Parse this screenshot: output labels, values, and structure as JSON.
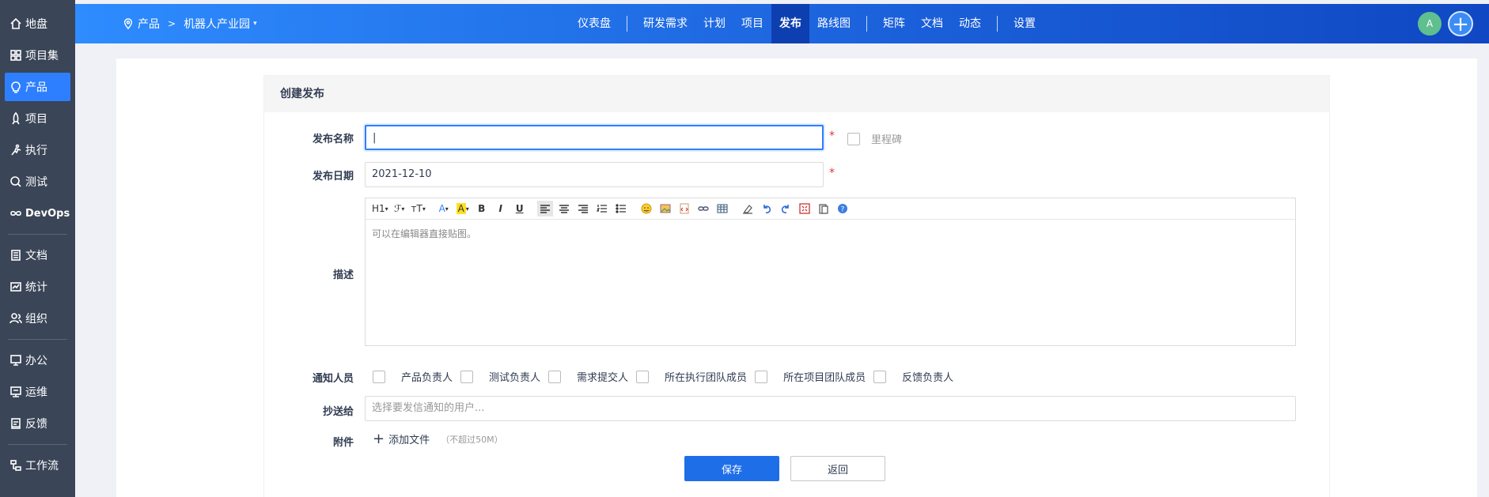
{
  "sidebar": {
    "items": [
      {
        "label": "地盘",
        "icon": "home-icon",
        "active": false
      },
      {
        "label": "项目集",
        "icon": "grid-icon",
        "active": false
      },
      {
        "label": "产品",
        "icon": "lightbulb-icon",
        "active": true
      },
      {
        "label": "项目",
        "icon": "rocket-icon",
        "active": false
      },
      {
        "label": "执行",
        "icon": "run-icon",
        "active": false
      },
      {
        "label": "测试",
        "icon": "magnifier-icon",
        "active": false
      },
      {
        "label": "DevOps",
        "icon": "infinity-icon",
        "active": false
      },
      {
        "label": "文档",
        "icon": "document-icon",
        "active": false
      },
      {
        "label": "统计",
        "icon": "chart-icon",
        "active": false
      },
      {
        "label": "组织",
        "icon": "people-icon",
        "active": false
      },
      {
        "label": "办公",
        "icon": "office-icon",
        "active": false
      },
      {
        "label": "运维",
        "icon": "ops-icon",
        "active": false
      },
      {
        "label": "反馈",
        "icon": "feedback-icon",
        "active": false
      },
      {
        "label": "工作流",
        "icon": "workflow-icon",
        "active": false
      }
    ]
  },
  "header": {
    "breadcrumb": {
      "root": "产品",
      "separator": ">",
      "current": "机器人产业园"
    },
    "nav": [
      {
        "label": "仪表盘"
      },
      {
        "label": "研发需求"
      },
      {
        "label": "计划"
      },
      {
        "label": "项目"
      },
      {
        "label": "发布",
        "active": true
      },
      {
        "label": "路线图"
      },
      {
        "label": "矩阵"
      },
      {
        "label": "文档"
      },
      {
        "label": "动态"
      },
      {
        "label": "设置"
      }
    ],
    "avatar": "A",
    "plus": "+"
  },
  "form": {
    "title": "创建发布",
    "name_label": "发布名称",
    "name_value": "",
    "required_mark": "*",
    "milestone_label": "里程碑",
    "date_label": "发布日期",
    "date_value": "2021-12-10",
    "desc_label": "描述",
    "desc_placeholder": "可以在编辑器直接贴图。",
    "toolbar": {
      "heading": "H1",
      "font": "ℱ",
      "size": "ᴛT",
      "font_color": "A",
      "bg_color": "A",
      "bold": "B",
      "italic": "I",
      "underline": "U"
    },
    "notify_label": "通知人员",
    "notify_options": [
      "产品负责人",
      "测试负责人",
      "需求提交人",
      "所在执行团队成员",
      "所在项目团队成员",
      "反馈负责人"
    ],
    "cc_label": "抄送给",
    "cc_placeholder": "选择要发信通知的用户...",
    "attach_label": "附件",
    "add_file": "添加文件",
    "add_file_note": "（不超过50M）",
    "save": "保存",
    "back": "返回"
  },
  "colors": {
    "primary": "#1e6ee8",
    "sidebar": "#3a4557",
    "active": "#2e7fff",
    "required": "#e53333"
  }
}
